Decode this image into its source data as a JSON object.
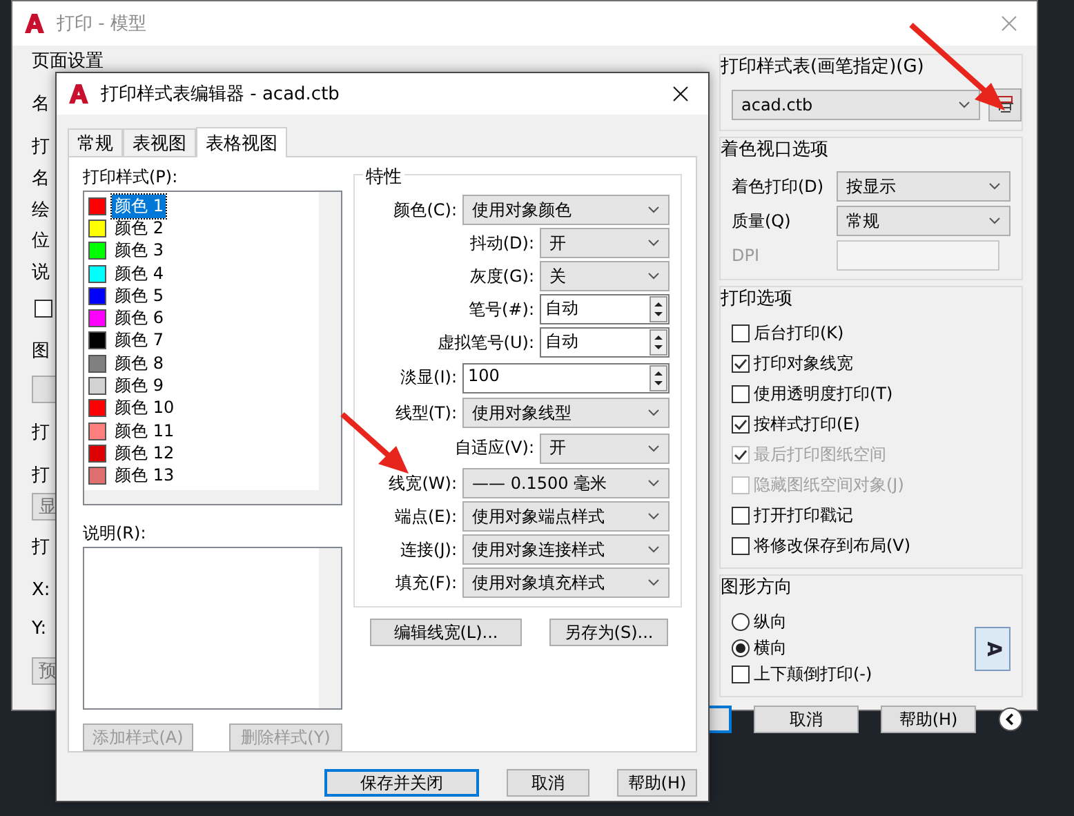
{
  "main_window": {
    "title": "打印 - 模型",
    "fragments": [
      {
        "kind": "group",
        "text": "页面设置"
      },
      {
        "kind": "label",
        "text": "名"
      },
      {
        "kind": "group",
        "text": "打"
      },
      {
        "kind": "label",
        "text": "名"
      },
      {
        "kind": "label",
        "text": "绘"
      },
      {
        "kind": "label",
        "text": "位"
      },
      {
        "kind": "label",
        "text": "说"
      },
      {
        "kind": "check",
        "checked": false
      },
      {
        "kind": "group",
        "text": "图"
      },
      {
        "kind": "button"
      },
      {
        "kind": "group",
        "text": "打"
      },
      {
        "kind": "label",
        "text": "打"
      },
      {
        "kind": "button",
        "text": "显"
      },
      {
        "kind": "group",
        "text": "打"
      },
      {
        "kind": "label",
        "text": "X:"
      },
      {
        "kind": "label",
        "text": "Y:"
      },
      {
        "kind": "button",
        "text": "预"
      }
    ]
  },
  "plot_style_table": {
    "label": "打印样式表(画笔指定)(G)",
    "value": "acad.ctb"
  },
  "shaded_viewport": {
    "label": "着色视口选项",
    "fields": [
      {
        "label": "着色打印(D)",
        "kind": "select",
        "value": "按显示",
        "disabled": false
      },
      {
        "label": "质量(Q)",
        "kind": "select",
        "value": "常规",
        "disabled": false
      },
      {
        "label": "DPI",
        "kind": "input",
        "disabled": true
      }
    ]
  },
  "plot_options": {
    "label": "打印选项",
    "items": [
      {
        "label": "后台打印(K)",
        "checked": false,
        "disabled": false
      },
      {
        "label": "打印对象线宽",
        "checked": true,
        "disabled": false
      },
      {
        "label": "使用透明度打印(T)",
        "checked": false,
        "disabled": false
      },
      {
        "label": "按样式打印(E)",
        "checked": true,
        "disabled": false
      },
      {
        "label": "最后打印图纸空间",
        "checked": true,
        "disabled": true
      },
      {
        "label": "隐藏图纸空间对象(J)",
        "checked": false,
        "disabled": true
      },
      {
        "label": "打开打印戳记",
        "checked": false,
        "disabled": false
      },
      {
        "label": "将修改保存到布局(V)",
        "checked": false,
        "disabled": false
      }
    ]
  },
  "orientation": {
    "label": "图形方向",
    "options": [
      {
        "label": "纵向",
        "selected": false
      },
      {
        "label": "横向",
        "selected": true
      }
    ],
    "upside_down": {
      "label": "上下颠倒打印(-)",
      "checked": false
    },
    "preview_letter": "A"
  },
  "buttons": [
    "取消",
    "帮助(H)"
  ],
  "editor": {
    "title": "打印样式表编辑器 - acad.ctb",
    "tabs": [
      {
        "label": "常规",
        "selected": false
      },
      {
        "label": "表视图",
        "selected": false
      },
      {
        "label": "表格视图",
        "selected": true
      }
    ],
    "styles_label": "打印样式(P):",
    "styles": [
      {
        "name": "颜色 1",
        "color": "#ff0000",
        "selected": true
      },
      {
        "name": "颜色 2",
        "color": "#ffff00",
        "selected": false
      },
      {
        "name": "颜色 3",
        "color": "#00ff00",
        "selected": false
      },
      {
        "name": "颜色 4",
        "color": "#00ffff",
        "selected": false
      },
      {
        "name": "颜色 5",
        "color": "#0000ff",
        "selected": false
      },
      {
        "name": "颜色 6",
        "color": "#ff00ff",
        "selected": false
      },
      {
        "name": "颜色 7",
        "color": "#000000",
        "selected": false
      },
      {
        "name": "颜色 8",
        "color": "#808080",
        "selected": false
      },
      {
        "name": "颜色 9",
        "color": "#d3d3d3",
        "selected": false
      },
      {
        "name": "颜色 10",
        "color": "#ff0000",
        "selected": false
      },
      {
        "name": "颜色 11",
        "color": "#ff7f7f",
        "selected": false
      },
      {
        "name": "颜色 12",
        "color": "#dd0000",
        "selected": false
      },
      {
        "name": "颜色 13",
        "color": "#e07070",
        "selected": false
      }
    ],
    "description_label": "说明(R):",
    "style_buttons": [
      {
        "label": "添加样式(A)",
        "disabled": true
      },
      {
        "label": "删除样式(Y)",
        "disabled": true
      }
    ],
    "properties_label": "特性",
    "properties": [
      {
        "label": "颜色(C):",
        "kind": "select",
        "value": "使用对象颜色"
      },
      {
        "label": "抖动(D):",
        "kind": "narrow-select",
        "value": "开"
      },
      {
        "label": "灰度(G):",
        "kind": "narrow-select",
        "value": "关"
      },
      {
        "label": "笔号(#):",
        "kind": "narrow-spin",
        "value": "自动"
      },
      {
        "label": "虚拟笔号(U):",
        "kind": "narrow-spin",
        "value": "自动"
      },
      {
        "label": "淡显(I):",
        "kind": "spin",
        "value": "100"
      },
      {
        "label": "线型(T):",
        "kind": "select",
        "value": "使用对象线型"
      },
      {
        "label": "自适应(V):",
        "kind": "narrow-select",
        "value": "开"
      },
      {
        "label": "线宽(W):",
        "kind": "select",
        "value": "—— 0.1500 毫米"
      },
      {
        "label": "端点(E):",
        "kind": "select",
        "value": "使用对象端点样式"
      },
      {
        "label": "连接(J):",
        "kind": "select",
        "value": "使用对象连接样式"
      },
      {
        "label": "填充(F):",
        "kind": "select",
        "value": "使用对象填充样式"
      }
    ],
    "property_buttons": [
      "编辑线宽(L)...",
      "另存为(S)..."
    ],
    "footer_buttons": [
      {
        "label": "保存并关闭",
        "default": true
      },
      {
        "label": "取消",
        "default": false
      },
      {
        "label": "帮助(H)",
        "default": false
      }
    ]
  }
}
